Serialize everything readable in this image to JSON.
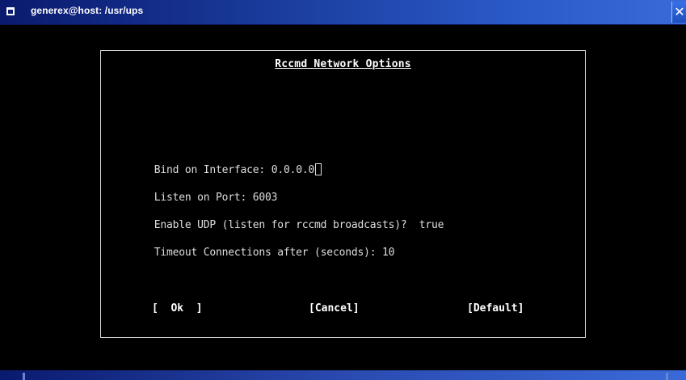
{
  "window": {
    "title": "generex@host: /usr/ups",
    "close_glyph": "✕"
  },
  "dialog": {
    "title": "Rccmd Network Options",
    "fields": [
      {
        "label": "Bind on Interface: ",
        "value": "0.0.0.0"
      },
      {
        "label": "Listen on Port: ",
        "value": "6003"
      },
      {
        "label": "Enable UDP (listen for rccmd broadcasts)?  ",
        "value": "true"
      },
      {
        "label": "Timeout Connections after (seconds): ",
        "value": "10"
      }
    ],
    "buttons": {
      "ok": "[  Ok  ]",
      "cancel": "[Cancel]",
      "default": "[Default]"
    }
  },
  "colors": {
    "titlebar_start": "#0a1a6e",
    "titlebar_end": "#3a6ad8",
    "terminal_bg": "#000000",
    "terminal_fg": "#dedede"
  },
  "icons": {
    "system_menu": "window-menu-icon",
    "close": "close-icon"
  }
}
